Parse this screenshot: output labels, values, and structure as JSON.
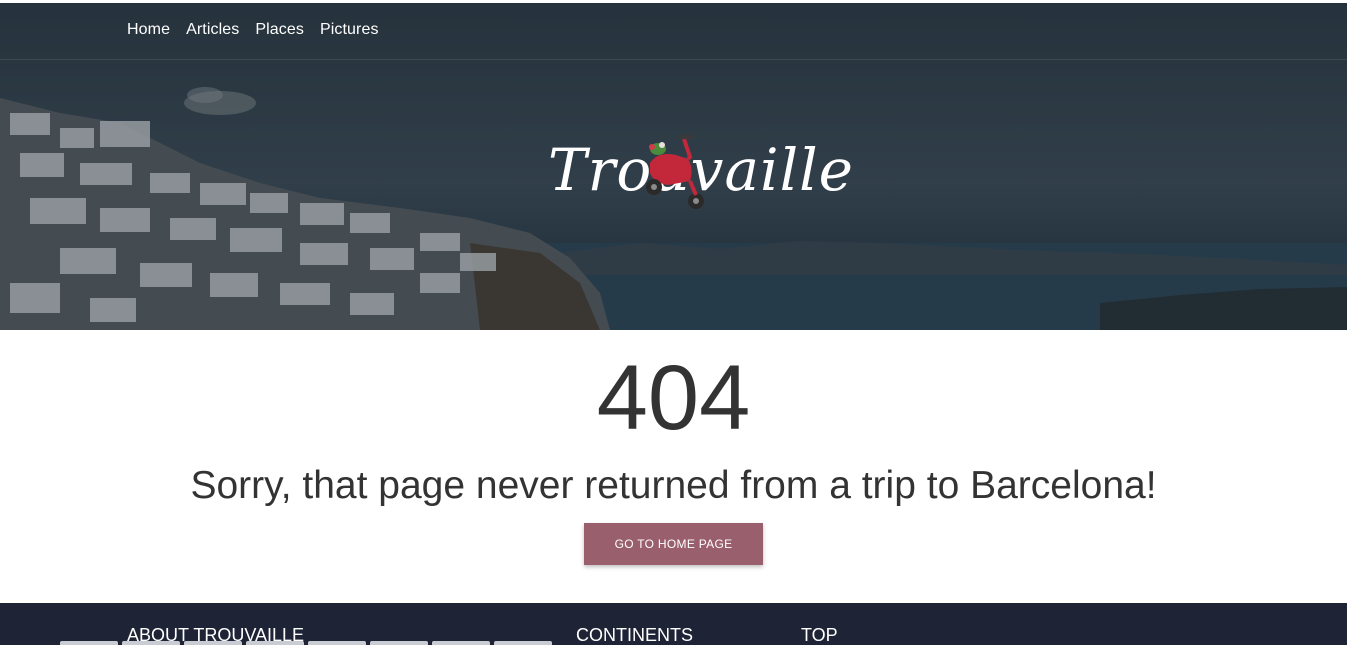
{
  "nav": {
    "items": [
      "Home",
      "Articles",
      "Places",
      "Pictures"
    ]
  },
  "logo": {
    "text": "Trouvaille"
  },
  "error": {
    "code": "404",
    "message": "Sorry, that page never returned from a trip to Barcelona!",
    "button_label": "GO TO HOME PAGE"
  },
  "footer": {
    "about_heading": "ABOUT TROUVAILLE",
    "continents_heading": "CONTINENTS",
    "top_heading": "TOP"
  },
  "colors": {
    "accent": "#9a5f6d",
    "footer_bg": "#1e2336",
    "text": "#333333"
  }
}
